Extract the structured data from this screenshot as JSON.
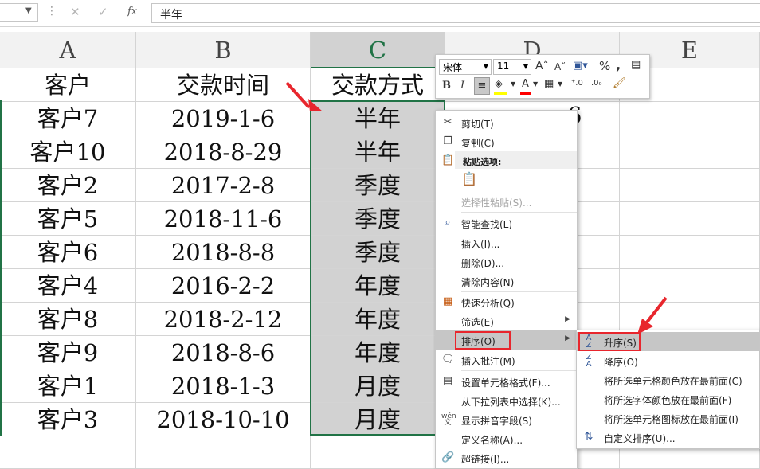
{
  "formula_bar": {
    "name_box": "",
    "fx": "fx",
    "cancel": "✕",
    "enter": "✓",
    "value": "半年"
  },
  "columns": [
    "A",
    "B",
    "C",
    "D",
    "E"
  ],
  "headers": {
    "a": "客户",
    "b": "交款时间",
    "c": "交款方式"
  },
  "rows": [
    {
      "a": "客户7",
      "b": "2019-1-6",
      "c": "半年"
    },
    {
      "a": "客户10",
      "b": "2018-8-29",
      "c": "半年"
    },
    {
      "a": "客户2",
      "b": "2017-2-8",
      "c": "季度"
    },
    {
      "a": "客户5",
      "b": "2018-11-6",
      "c": "季度"
    },
    {
      "a": "客户6",
      "b": "2018-8-8",
      "c": "季度"
    },
    {
      "a": "客户4",
      "b": "2016-2-2",
      "c": "年度"
    },
    {
      "a": "客户8",
      "b": "2018-2-12",
      "c": "年度"
    },
    {
      "a": "客户9",
      "b": "2018-8-6",
      "c": "年度"
    },
    {
      "a": "客户1",
      "b": "2018-1-3",
      "c": "月度"
    },
    {
      "a": "客户3",
      "b": "2018-10-10",
      "c": "月度"
    }
  ],
  "d_partial": "6",
  "mini_toolbar": {
    "font": "宋体",
    "size": "11",
    "percent": "%",
    "comma": ",",
    "bold": "B",
    "italic": "I"
  },
  "context_menu": {
    "cut": "剪切(T)",
    "copy": "复制(C)",
    "paste_options": "粘贴选项:",
    "paste_special": "选择性粘贴(S)...",
    "smart_lookup": "智能查找(L)",
    "insert": "插入(I)...",
    "delete": "删除(D)...",
    "clear": "清除内容(N)",
    "quick_analysis": "快速分析(Q)",
    "filter": "筛选(E)",
    "sort": "排序(O)",
    "insert_comment": "插入批注(M)",
    "format_cells": "设置单元格格式(F)...",
    "pick_list": "从下拉列表中选择(K)...",
    "phonetic": "显示拼音字段(S)",
    "define_name": "定义名称(A)...",
    "hyperlink": "超链接(I)..."
  },
  "sort_submenu": {
    "asc": "升序(S)",
    "desc": "降序(O)",
    "cell_color": "将所选单元格颜色放在最前面(C)",
    "font_color": "将所选字体颜色放在最前面(F)",
    "icon": "将所选单元格图标放在最前面(I)",
    "custom": "自定义排序(U)..."
  },
  "colors": {
    "accent_green": "#217346",
    "highlight_red": "#e8262d",
    "selection_gray": "#d2d2d2"
  }
}
